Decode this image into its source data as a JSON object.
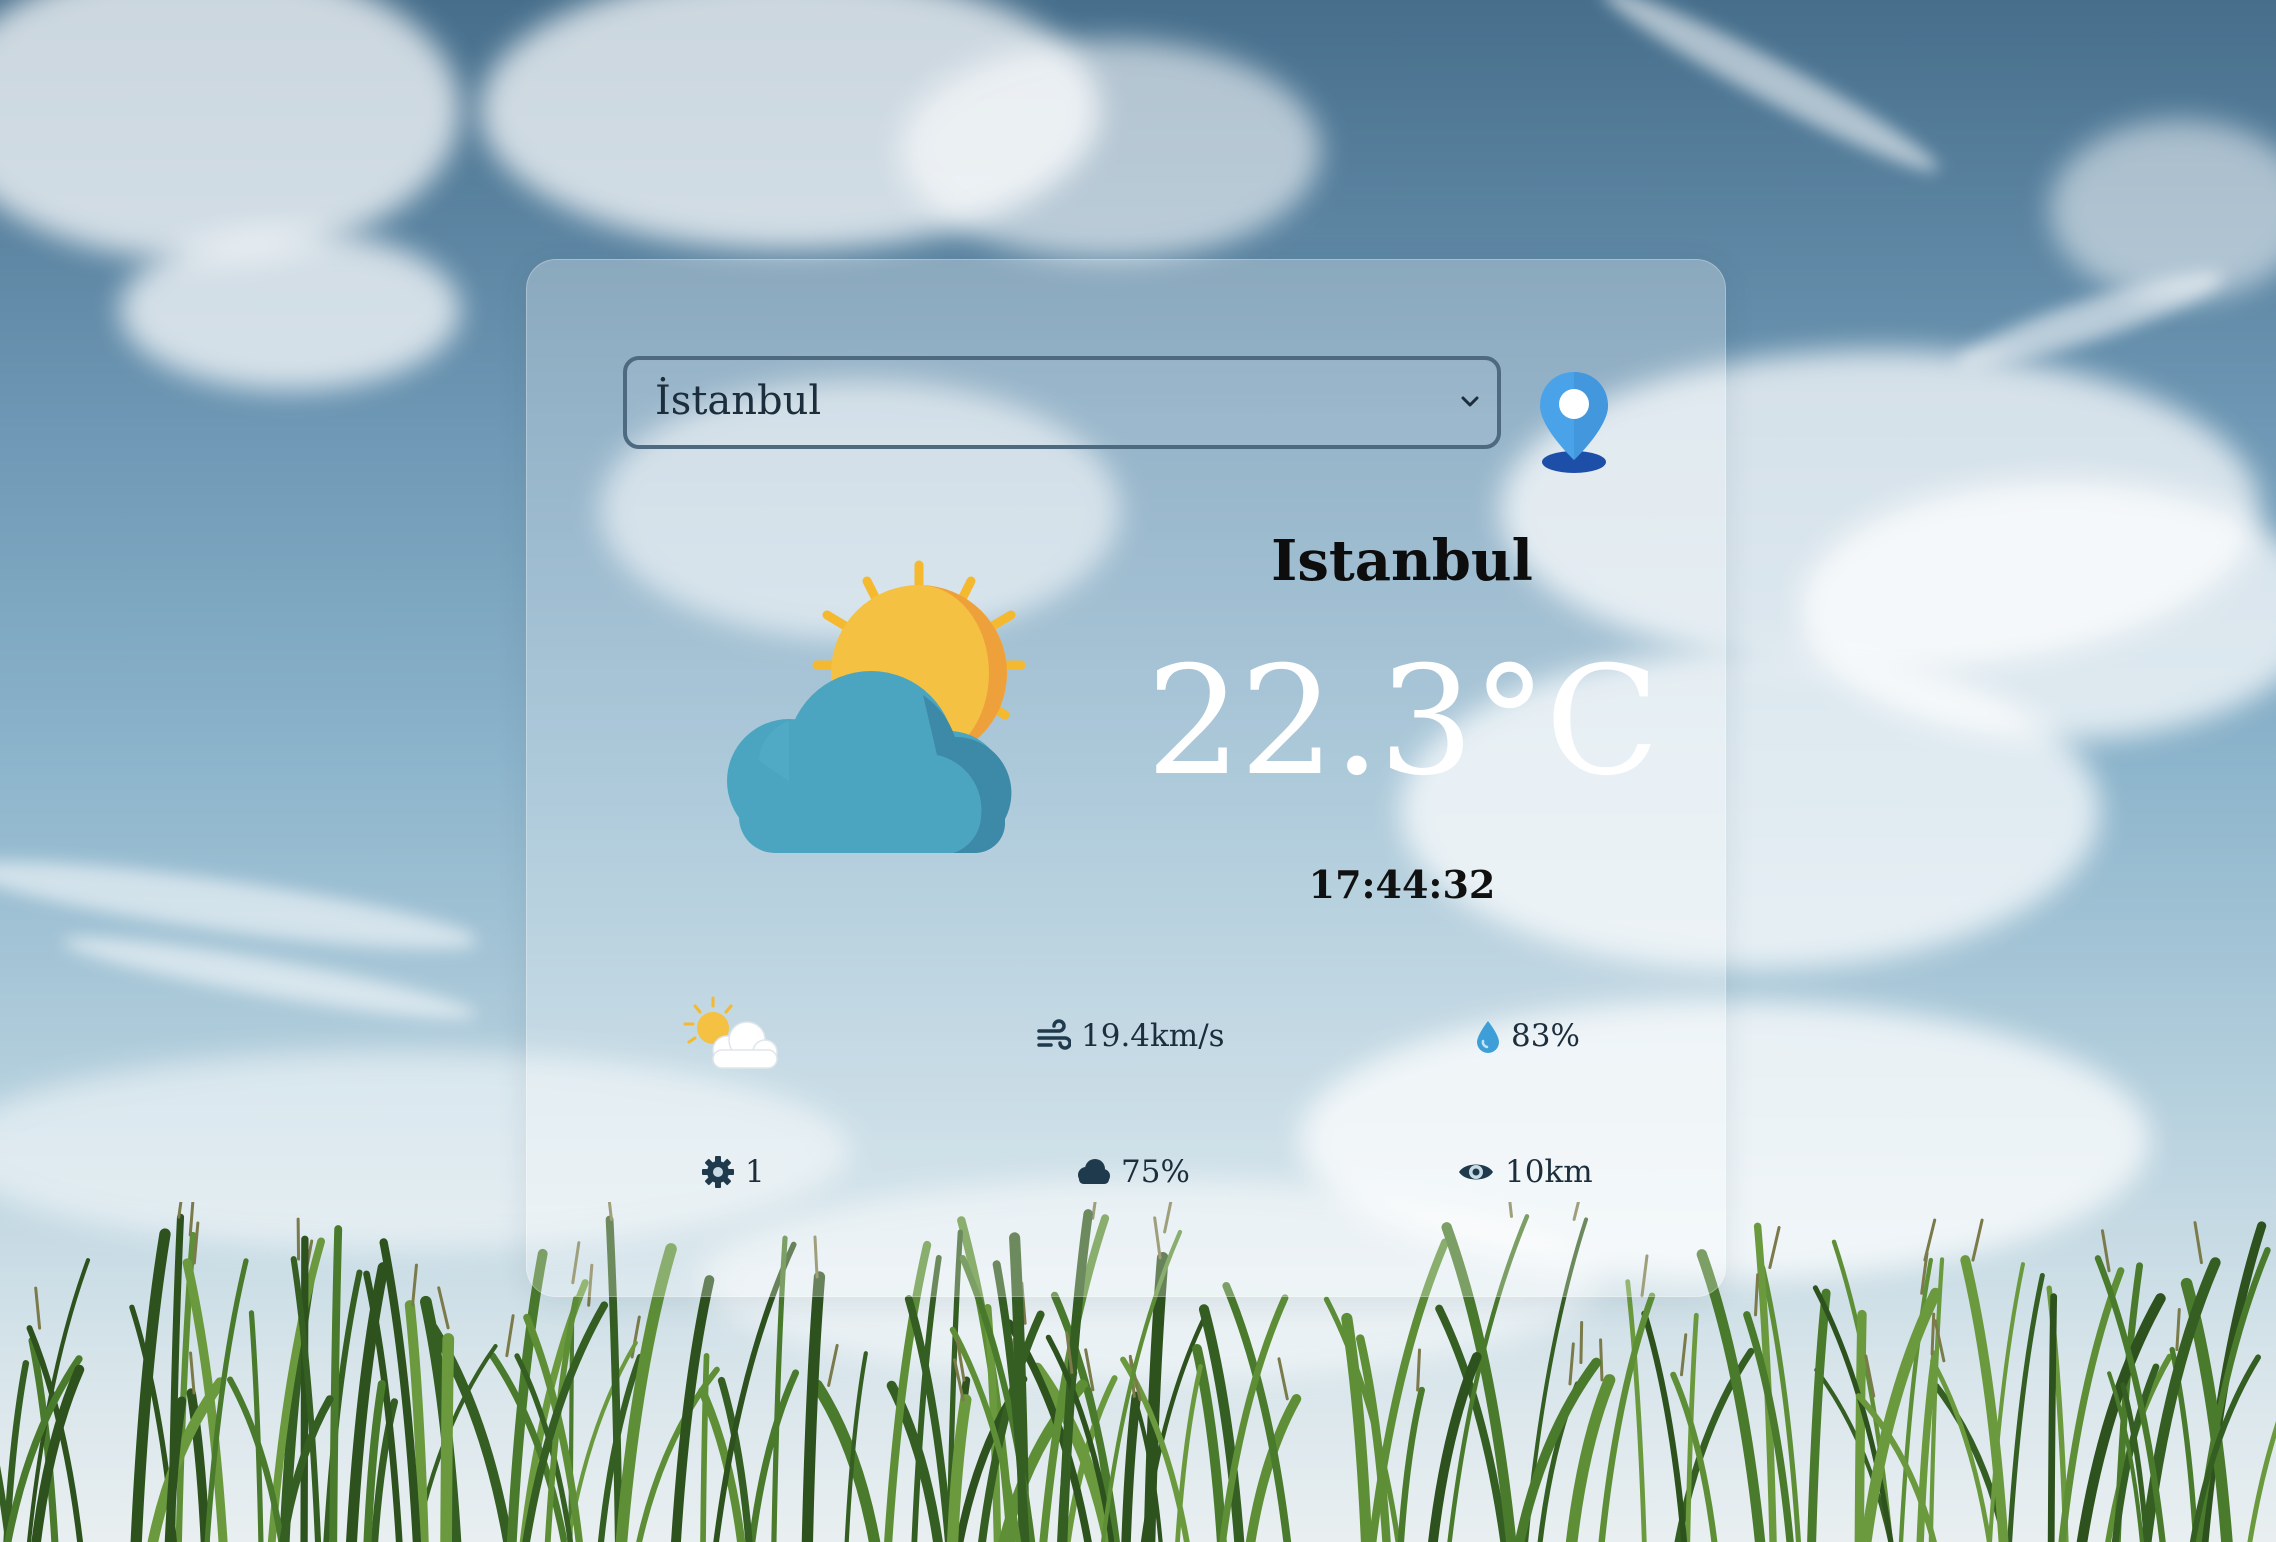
{
  "location_select": {
    "selected": "İstanbul"
  },
  "weather": {
    "city": "Istanbul",
    "temperature": "22.3°C",
    "time": "17:44:32",
    "condition_icon": "sun-behind-cloud-icon"
  },
  "stats": {
    "wind": "19.4km/s",
    "humidity": "83%",
    "uv": "1",
    "clouds": "75%",
    "visibility": "10km"
  },
  "colors": {
    "card": "rgba(255,255,255,0.28)",
    "text_dark": "#1c2d3c",
    "temperature_text": "#ffffff",
    "pin": "#4aa3e8",
    "cloud_icon": "#4ca5c0",
    "sun_icon": "#f4c142"
  }
}
